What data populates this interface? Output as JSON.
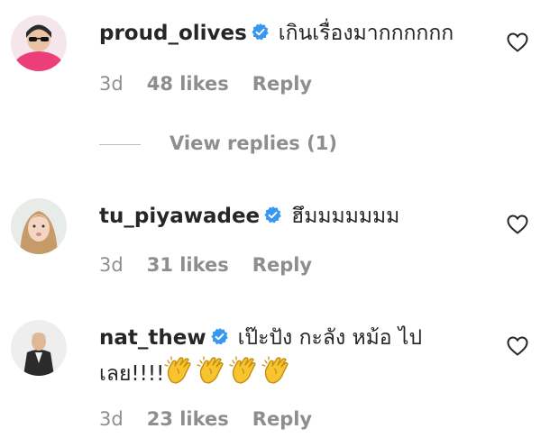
{
  "comments": [
    {
      "username": "proud_olives",
      "text": "เกินเรื่องมากกกกกก",
      "time": "3d",
      "likes": "48 likes",
      "reply": "Reply",
      "view_replies": "View replies (1)",
      "avatar_icon": "avatar-proud-olives"
    },
    {
      "username": "tu_piyawadee",
      "text": "ฮึมมมมมมม",
      "time": "3d",
      "likes": "31 likes",
      "reply": "Reply",
      "avatar_icon": "avatar-tu-piyawadee"
    },
    {
      "username": "nat_thew",
      "text_line1": "เป๊ะปัง กะลัง หม้อ ไป",
      "text_line2": "เลย!!!!",
      "emoji": "clapping-hands-icon",
      "emoji_count": 4,
      "time": "3d",
      "likes": "23 likes",
      "reply": "Reply",
      "avatar_icon": "avatar-nat-thew"
    }
  ],
  "colors": {
    "text": "#262626",
    "meta": "#8e8e8e",
    "verified": "#3897f0",
    "clap": "#f7c32e"
  }
}
